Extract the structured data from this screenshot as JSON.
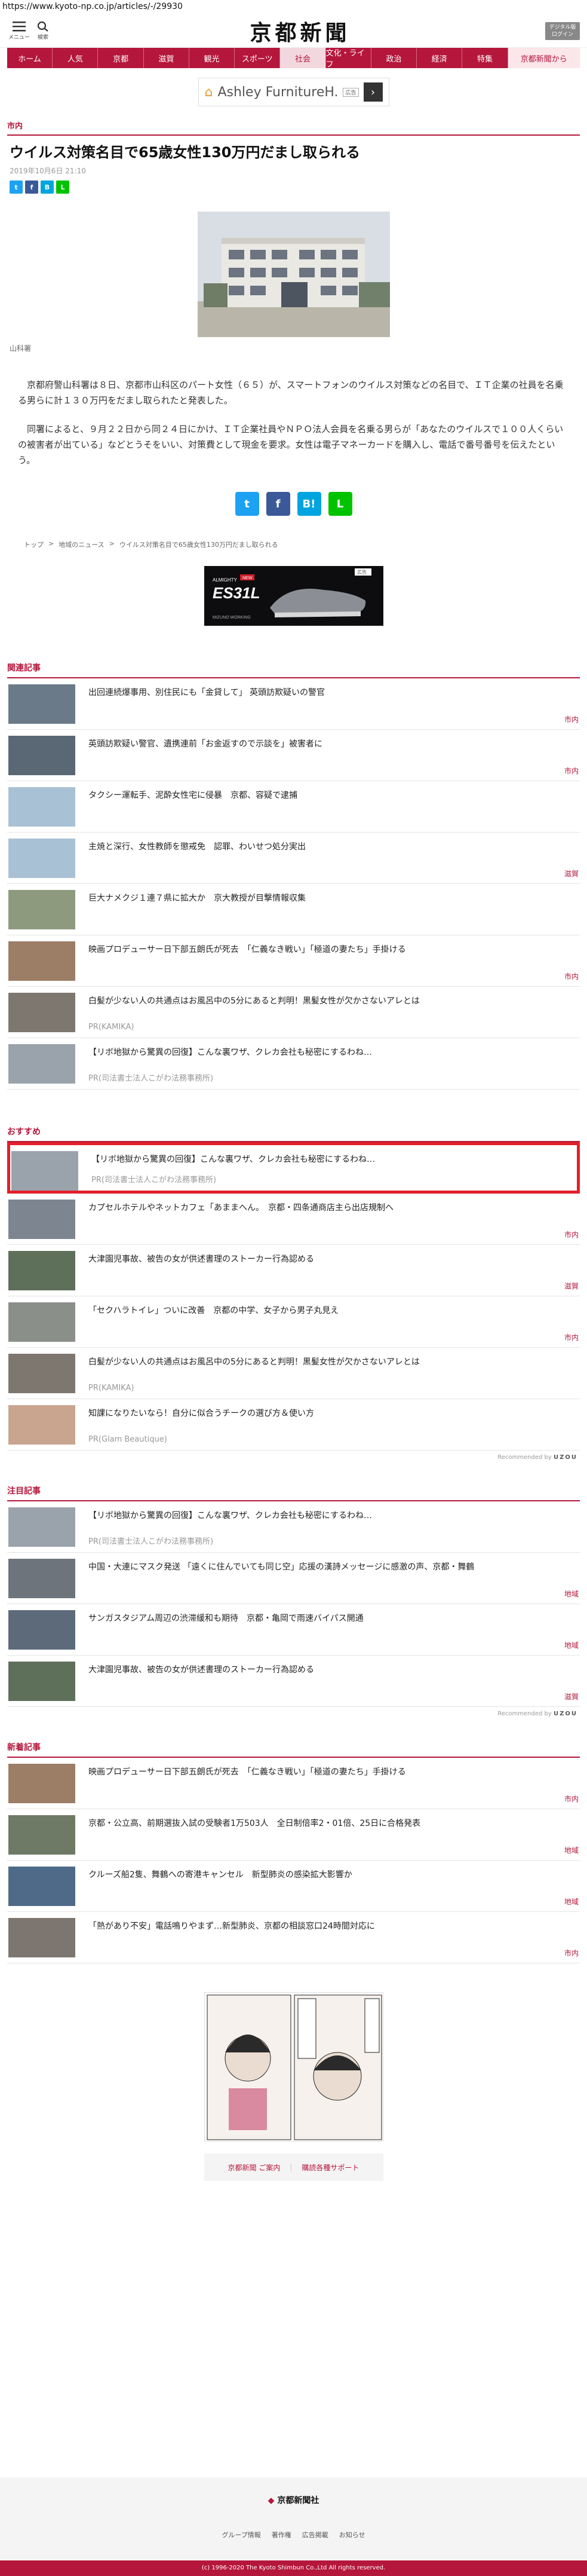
{
  "url": "https://www.kyoto-np.co.jp/articles/-/29930",
  "header": {
    "menu_label": "メニュー",
    "search_label": "検索",
    "logo": "京都新聞",
    "digital_label": "デジタル版\nログイン"
  },
  "nav": [
    "ホーム",
    "人気",
    "京都",
    "滋賀",
    "観光",
    "スポーツ",
    "社会",
    "文化・ライフ",
    "政治",
    "経済",
    "特集",
    "京都新聞から"
  ],
  "top_ad": {
    "text": "Ashley FurnitureH...",
    "mark": "広告"
  },
  "article": {
    "category": "市内",
    "headline": "ウイルス対策名目で65歳女性130万円だまし取られる",
    "date": "2019年10月6日 21:10",
    "caption": "山科署",
    "paragraphs": [
      "京都府警山科署は８日、京都市山科区のパート女性（６５）が、スマートフォンのウイルス対策などの名目で、ＩＴ企業の社員を名乗る男らに計１３０万円をだまし取られたと発表した。",
      "同署によると、９月２２日から同２４日にかけ、ＩＴ企業社員やＮＰＯ法人会員を名乗る男らが「あなたのウイルスで１００人くらいの被害者が出ている」などとうそをいい、対策費として現金を要求。女性は電子マネーカードを購入し、電話で番号番号を伝えたという。"
    ]
  },
  "breadcrumb": [
    "トップ",
    "地域のニュース",
    "ウイルス対策名目で65歳女性130万円だまし取られる"
  ],
  "mid_ad": {
    "brand": "ALMIGHTY",
    "model": "ES31L",
    "tag": "NEW",
    "footer": "MIZUNO WORKING",
    "mark": "広告"
  },
  "related": {
    "title": "関連記事",
    "items": [
      {
        "title": "出回連続爆事用、別住民にも「金貸して」 英頭訪欺疑いの警官",
        "tag": "市内"
      },
      {
        "title": "英頭訪欺疑い警官、遺携連前「お金返すので示談を」被害者に",
        "tag": "市内"
      },
      {
        "title": "タクシー運転手、泥酔女性宅に侵暴　京都、容疑で逮捕",
        "tag": ""
      },
      {
        "title": "主焼と深行、女性教師を懲戒免　認罪、わいせつ処分実出",
        "tag": "滋賀"
      },
      {
        "title": "巨大ナメクジ１連７県に拡大か　京大教授が目撃情報収集",
        "tag": ""
      },
      {
        "title": "映画プロデューサー日下部五朗氏が死去　「仁義なき戦い」「極道の妻たち」手掛ける",
        "tag": "市内"
      },
      {
        "title": "白髪が少ない人の共通点はお風呂中の5分にあると判明！黒髪女性が欠かさないアレとは",
        "pr": "PR(KAMIKA)"
      },
      {
        "title": "【リボ地獄から驚異の回復】こんな裏ワザ、クレカ会社も秘密にするわね…",
        "pr": "PR(司法書士法人こがわ法務事務所)"
      }
    ]
  },
  "recommend": {
    "title": "おすすめ",
    "items": [
      {
        "title": "【リボ地獄から驚異の回復】こんな裏ワザ、クレカ会社も秘密にするわね…",
        "pr": "PR(司法書士法人こがわ法務事務所)"
      },
      {
        "title": "カプセルホテルやネットカフェ「あままへん。　京都・四条通商店主ら出店規制へ",
        "tag": "市内"
      },
      {
        "title": "大津園児事故、被告の女が供述書理のストーカー行為認める",
        "tag": "滋賀"
      },
      {
        "title": "「セクハラトイレ」ついに改善　京都の中学、女子から男子丸見え",
        "tag": "市内"
      },
      {
        "title": "白髪が少ない人の共通点はお風呂中の5分にあると判明！黒髪女性が欠かさないアレとは",
        "pr": "PR(KAMIKA)"
      },
      {
        "title": "知課になりたいなら！自分に似合うチークの選び方＆使い方",
        "pr": "PR(Glam Beautique)"
      }
    ],
    "rec_by": "Recommended by",
    "rec_brand": "UZOU"
  },
  "featured": {
    "title": "注目記事",
    "items": [
      {
        "title": "【リボ地獄から驚異の回復】こんな裏ワザ、クレカ会社も秘密にするわね…",
        "pr": "PR(司法書士法人こがわ法務事務所)"
      },
      {
        "title": "中国・大連にマスク発送 「遠くに住んでいても同じ空」応援の漢詩メッセージに感激の声、京都・舞鶴",
        "tag": "地域"
      },
      {
        "title": "サンガスタジアム周辺の渋滞緩和も期待　京都・亀岡で雨速バイパス開通",
        "tag": "地域"
      },
      {
        "title": "大津園児事故、被告の女が供述書理のストーカー行為認める",
        "tag": "滋賀"
      }
    ],
    "rec_by": "Recommended by",
    "rec_brand": "UZOU"
  },
  "latest": {
    "title": "新着記事",
    "items": [
      {
        "title": "映画プロデューサー日下部五朗氏が死去　「仁義なき戦い」「極道の妻たち」手掛ける",
        "tag": "市内"
      },
      {
        "title": "京都・公立高、前期選抜入試の受験者1万503人　全日制倍率2・01倍、25日に合格発表",
        "tag": "地域"
      },
      {
        "title": "クルーズ船2隻、舞鶴への寄港キャンセル　新型肺炎の感染拡大影響か",
        "tag": "地域"
      },
      {
        "title": "「熱があり不安」電話鳴りやまず…新型肺炎、京都の相談窓口24時間対応に",
        "tag": "市内"
      }
    ]
  },
  "links": {
    "contact": "京都新聞 ご案内",
    "feedback": "購読各種サポート"
  },
  "footer": {
    "logo_prefix": "◆",
    "logo": "京都新聞社",
    "links": [
      "グループ情報",
      "著作権",
      "広告掲載",
      "お知らせ"
    ],
    "copyright": "(c) 1996-2020 The Kyoto Shimbun Co.,Ltd All rights reserved."
  },
  "colors": {
    "brand": "#b5163b",
    "highlight": "#e2202a"
  }
}
